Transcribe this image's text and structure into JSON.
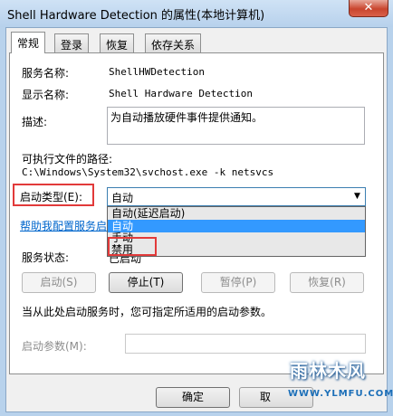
{
  "window": {
    "title": "Shell Hardware Detection 的属性(本地计算机)",
    "close_glyph": "✕"
  },
  "tabs": [
    {
      "label": "常规",
      "active": true
    },
    {
      "label": "登录"
    },
    {
      "label": "恢复"
    },
    {
      "label": "依存关系"
    }
  ],
  "general": {
    "service_name_label": "服务名称:",
    "service_name": "ShellHWDetection",
    "display_name_label": "显示名称:",
    "display_name": "Shell Hardware Detection",
    "description_label": "描述:",
    "description": "为自动播放硬件事件提供通知。",
    "exe_path_label": "可执行文件的路径:",
    "exe_path": "C:\\Windows\\System32\\svchost.exe -k netsvcs",
    "startup_type_label": "启动类型(E):",
    "startup_type_value": "自动",
    "startup_options": [
      "自动(延迟启动)",
      "自动",
      "手动",
      "禁用"
    ],
    "startup_selected_index": 1,
    "help_link": "帮助我配置服务启",
    "service_status_label": "服务状态:",
    "service_status": "已启动",
    "start_btn": "启动(S)",
    "stop_btn": "停止(T)",
    "pause_btn": "暂停(P)",
    "resume_btn": "恢复(R)",
    "hint": "当从此处启动服务时，您可指定所适用的启动参数。",
    "params_label": "启动参数(M):",
    "params_value": ""
  },
  "footer": {
    "ok_btn": "确定",
    "cancel_btn": "取"
  },
  "watermark": {
    "title": "雨林木风",
    "url": "WWW.YLMFU.COM"
  },
  "colors": {
    "highlight": "#e23a3a",
    "selection": "#3399ff",
    "link": "#0066cc"
  }
}
